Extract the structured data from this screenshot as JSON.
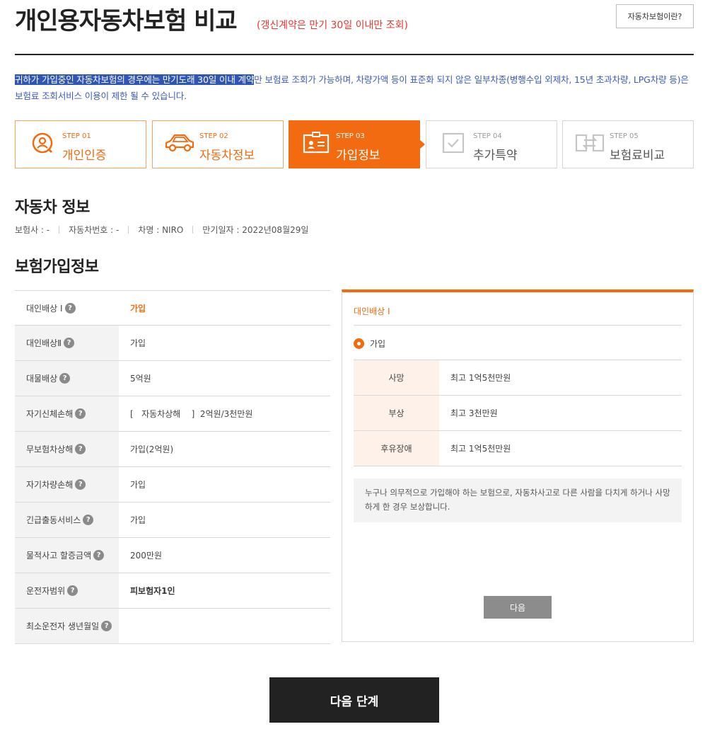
{
  "header": {
    "title": "개인용자동차보험 비교",
    "subtitle": "(갱신계약은 만기 30일 이내만 조회)",
    "info_button": "자동차보험이란?"
  },
  "notice": {
    "highlight": "귀하가 가입중인 자동차보험의 경우에는 만기도래 30일 이내 계약",
    "rest": "만 보험료 조회가 가능하며, 차량가액 등이 표준화 되지 않은 일부차종(병행수입 외제차, 15년 초과차량, LPG차량 등)은 보험료 조회서비스 이용이 제한 될 수 있습니다."
  },
  "steps": [
    {
      "num": "STEP 01",
      "label": "개인인증",
      "icon": "user-search-icon",
      "state": "done"
    },
    {
      "num": "STEP 02",
      "label": "자동차정보",
      "icon": "car-icon",
      "state": "done"
    },
    {
      "num": "STEP 03",
      "label": "가입정보",
      "icon": "id-card-icon",
      "state": "active"
    },
    {
      "num": "STEP 04",
      "label": "추가특약",
      "icon": "checkbox-icon",
      "state": "todo"
    },
    {
      "num": "STEP 05",
      "label": "보험료비교",
      "icon": "compare-icon",
      "state": "todo"
    }
  ],
  "car_section": {
    "title": "자동차 정보",
    "insurer": "보험사 : -",
    "car_number": "자동차번호 : -",
    "car_name": "차명 : NIRO",
    "expiry": "만기일자 : 2022년08월29일"
  },
  "insurance_section": {
    "title": "보험가입정보",
    "rows": [
      {
        "label": "대인배상 I",
        "value": "가입"
      },
      {
        "label": "대인배상Ⅱ",
        "value": "가입"
      },
      {
        "label": "대물배상",
        "value": "5억원"
      },
      {
        "label": "자기신체손해",
        "value": "[   자동차상해    ]  2억원/3천만원"
      },
      {
        "label": "무보험차상해",
        "value": "가입(2억원)"
      },
      {
        "label": "자기차량손해",
        "value": "가입"
      },
      {
        "label": "긴급출동서비스",
        "value": "가입"
      },
      {
        "label": "물적사고 할증금액",
        "value": "200만원"
      },
      {
        "label": "운전자범위",
        "value": "피보험자1인"
      },
      {
        "label": "최소운전자 생년월일",
        "value": ""
      }
    ],
    "help_symbol": "?"
  },
  "detail_panel": {
    "title": "대인배상 I",
    "option": "가입",
    "coverage": [
      {
        "label": "사망",
        "value": "최고 1억5천만원"
      },
      {
        "label": "부상",
        "value": "최고 3천만원"
      },
      {
        "label": "후유장애",
        "value": "최고 1억5천만원"
      }
    ],
    "description": "누구나 의무적으로 가입해야 하는 보험으로, 자동차사고로 다른 사람을 다치게 하거나 사망하게 한 경우 보상합니다.",
    "next_label": "다음"
  },
  "footer": {
    "next_step_label": "다음 단계"
  },
  "colors": {
    "accent": "#f26b10",
    "notice": "#3e5bb8",
    "alert": "#e8352e"
  }
}
